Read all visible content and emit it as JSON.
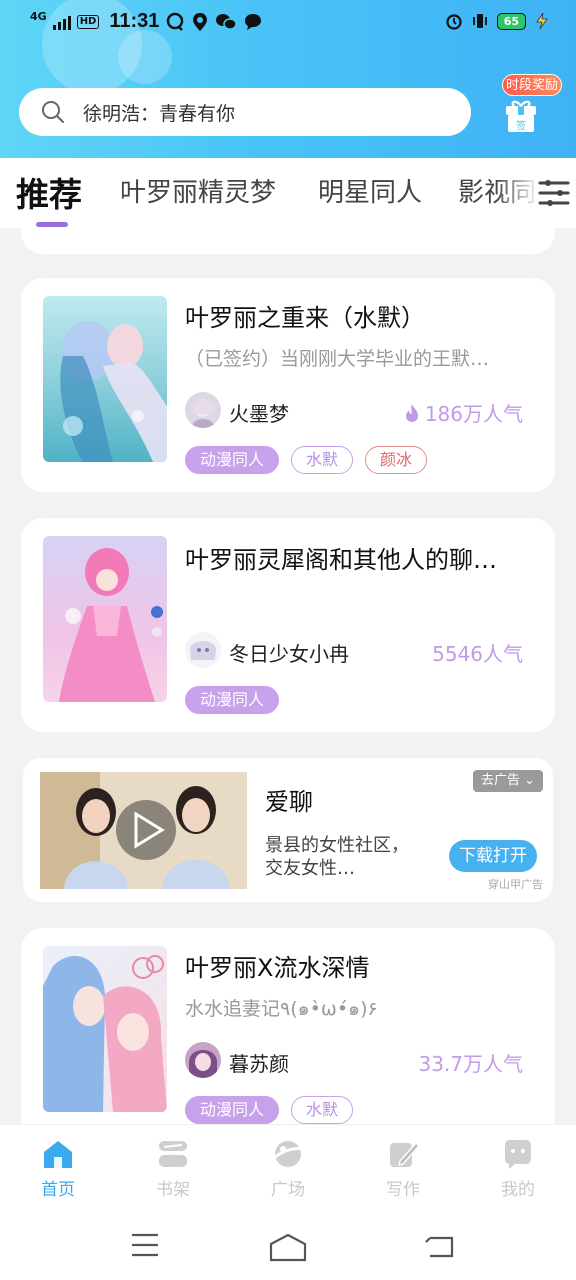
{
  "status_bar": {
    "network": "4G",
    "hd": "HD",
    "time": "11:31",
    "battery": "65"
  },
  "search": {
    "placeholder": "徐明浩：青春有你"
  },
  "reward": {
    "label": "时段奖励",
    "gift_label": "签"
  },
  "tabs": [
    {
      "label": "推荐",
      "active": true
    },
    {
      "label": "叶罗丽精灵梦",
      "active": false
    },
    {
      "label": "明星同人",
      "active": false
    },
    {
      "label": "影视同",
      "active": false
    }
  ],
  "cards": [
    {
      "title": "叶罗丽之重来（水默）",
      "desc": "（已签约）当刚刚大学毕业的王默…",
      "author": "火墨梦",
      "popularity": "186万人气",
      "tags": [
        "动漫同人",
        "水默",
        "颜冰"
      ]
    },
    {
      "title": "叶罗丽灵犀阁和其他人的聊…",
      "desc": "",
      "author": "冬日少女小冉",
      "popularity": "5546人气",
      "tags": [
        "动漫同人"
      ]
    },
    {
      "title": "叶罗丽X流水深情",
      "desc": "水水追妻记٩(๑•̀ω•́๑)۶",
      "author": "暮苏颜",
      "popularity": "33.7万人气",
      "tags": [
        "动漫同人",
        "水默"
      ]
    }
  ],
  "ad": {
    "title": "爱聊",
    "desc": "景县的女性社区，交友女性…",
    "dismiss": "去广告",
    "button": "下载打开",
    "source": "穿山甲广告"
  },
  "bottom_nav": [
    {
      "label": "首页",
      "icon": "home-icon",
      "active": true
    },
    {
      "label": "书架",
      "icon": "bookshelf-icon",
      "active": false
    },
    {
      "label": "广场",
      "icon": "planet-icon",
      "active": false
    },
    {
      "label": "写作",
      "icon": "pen-icon",
      "active": false
    },
    {
      "label": "我的",
      "icon": "chat-face-icon",
      "active": false
    }
  ],
  "colors": {
    "header_start": "#5fd6f6",
    "header_end": "#3fb2f5",
    "accent_purple": "#c7a2ea",
    "nav_active": "#38a9ee"
  }
}
